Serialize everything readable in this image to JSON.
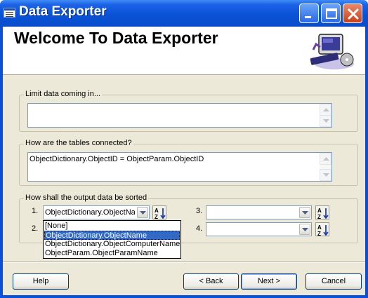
{
  "window": {
    "title": "Data Exporter",
    "colors": {
      "titlebar": "#0a52d6",
      "face": "#ece9d8",
      "selection": "#316ac5",
      "close": "#c6401a"
    }
  },
  "header": {
    "heading": "Welcome To Data Exporter",
    "icon": "computer-with-disk-icon"
  },
  "limit": {
    "legend": "Limit data coming in...",
    "value": ""
  },
  "connect": {
    "legend": "How are the tables connected?",
    "value": "ObjectDictionary.ObjectID = ObjectParam.ObjectID"
  },
  "sort": {
    "legend": "How shall the output data be sorted",
    "rows": [
      {
        "num": "1.",
        "value": "ObjectDictionary.ObjectNa"
      },
      {
        "num": "2.",
        "value": ""
      },
      {
        "num": "3.",
        "value": ""
      },
      {
        "num": "4.",
        "value": ""
      }
    ],
    "sort_icon": "sort-a-z-icon",
    "open_list": {
      "items": [
        "[None]",
        "ObjectDictionary.ObjectName",
        "ObjectDictionary.ObjectComputerName",
        "ObjectParam.ObjectParamName"
      ],
      "selected": "ObjectDictionary.ObjectName"
    }
  },
  "buttons": {
    "help": "Help",
    "back": "< Back",
    "next": "Next >",
    "cancel": "Cancel"
  }
}
